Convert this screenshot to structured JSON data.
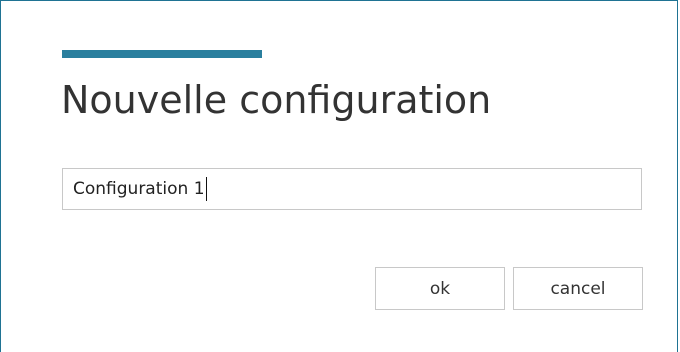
{
  "dialog": {
    "title": "Nouvelle configuration",
    "accent_color": "#2a7f9e",
    "border_color": "#1f7393"
  },
  "name_input": {
    "value": "Configuration 1"
  },
  "buttons": {
    "ok_label": "ok",
    "cancel_label": "cancel"
  }
}
